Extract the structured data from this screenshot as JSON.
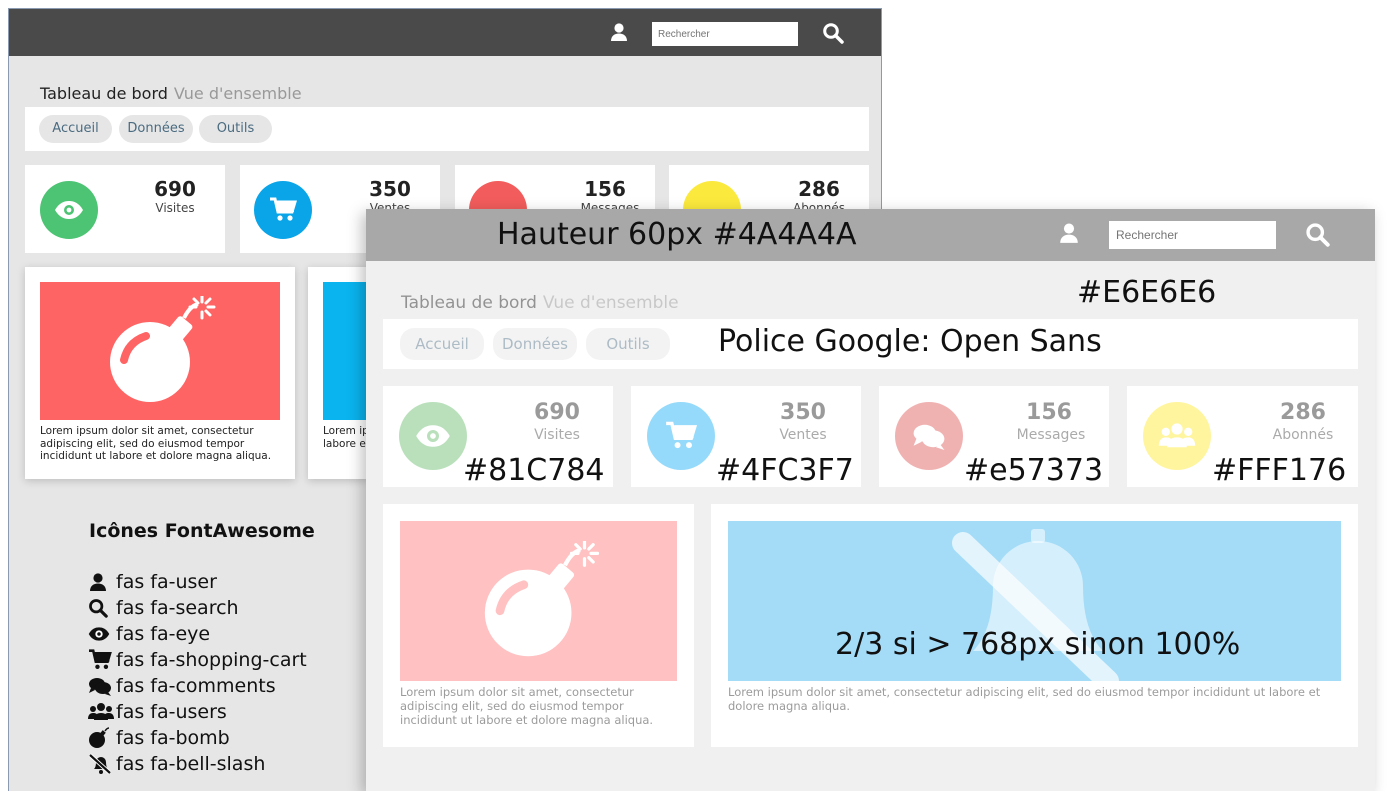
{
  "back": {
    "search_placeholder": "Rechercher",
    "title": "Tableau de bord",
    "subtitle": "Vue d'ensemble",
    "tabs": [
      {
        "label": "Accueil"
      },
      {
        "label": "Données"
      },
      {
        "label": "Outils"
      }
    ],
    "stats": [
      {
        "value": "690",
        "label": "Visites",
        "color": "#4cc473",
        "icon": "eye-icon"
      },
      {
        "value": "350",
        "label": "Ventes",
        "color": "#0aa5e8",
        "icon": "shopping-cart-icon"
      },
      {
        "value": "156",
        "label": "Messages",
        "color": "#f25c5c",
        "icon": "comments-icon"
      },
      {
        "value": "286",
        "label": "Abonnés",
        "color": "#fbe93d",
        "icon": "users-icon"
      }
    ],
    "cards": [
      {
        "text": "Lorem ipsum dolor sit amet, consectetur adipiscing elit, sed do eiusmod tempor incididunt ut labore et dolore magna aliqua.",
        "color": "#ff6464",
        "icon": "bomb-icon"
      },
      {
        "text": "Lorem ipsum dolor sit amet, consectetur adipiscing elit, sed do eiusmod tempor incididunt ut labore et dolore magna aliqua.",
        "color": "#0ab4ee",
        "icon": "bell-slash-icon"
      }
    ],
    "card2_visible_text": "Lorem ip",
    "card2_visible_text_2": "labore e"
  },
  "legend": {
    "title": "Icônes FontAwesome",
    "items": [
      {
        "label": "fas fa-user",
        "icon": "user-icon"
      },
      {
        "label": "fas fa-search",
        "icon": "search-icon"
      },
      {
        "label": "fas fa-eye",
        "icon": "eye-icon"
      },
      {
        "label": "fas fa-shopping-cart",
        "icon": "shopping-cart-icon"
      },
      {
        "label": "fas fa-comments",
        "icon": "comments-icon"
      },
      {
        "label": "fas fa-users",
        "icon": "users-icon"
      },
      {
        "label": "fas fa-bomb",
        "icon": "bomb-icon"
      },
      {
        "label": "fas fa-bell-slash",
        "icon": "bell-slash-icon"
      }
    ]
  },
  "front": {
    "header_annotation": "Hauteur 60px #4A4A4A",
    "search_placeholder": "Rechercher",
    "bg_annotation": "#E6E6E6",
    "title": "Tableau de bord",
    "subtitle": "Vue d'ensemble",
    "tabs": [
      {
        "label": "Accueil"
      },
      {
        "label": "Données"
      },
      {
        "label": "Outils"
      }
    ],
    "font_annotation": "Police Google: Open Sans",
    "stats": [
      {
        "value": "690",
        "label": "Visites",
        "color": "#81C784",
        "annotation": "#81C784",
        "icon": "eye-icon"
      },
      {
        "value": "350",
        "label": "Ventes",
        "color": "#4FC3F7",
        "annotation": "#4FC3F7",
        "icon": "shopping-cart-icon"
      },
      {
        "value": "156",
        "label": "Messages",
        "color": "#e57373",
        "annotation": "#e57373",
        "icon": "comments-icon"
      },
      {
        "value": "286",
        "label": "Abonnés",
        "color": "#FFF176",
        "annotation": "#FFF176",
        "icon": "users-icon"
      }
    ],
    "card_left_text": "Lorem ipsum dolor sit amet, consectetur adipiscing elit, sed do eiusmod tempor incididunt ut labore et dolore magna aliqua.",
    "card_right_text": "Lorem ipsum dolor sit amet, consectetur adipiscing elit, sed do eiusmod tempor incididunt ut labore et dolore magna aliqua.",
    "card_right_annotation": "2/3 si > 768px sinon 100%",
    "card_left_color": "#ffc1c1",
    "card_right_color": "#a4dcf8"
  }
}
